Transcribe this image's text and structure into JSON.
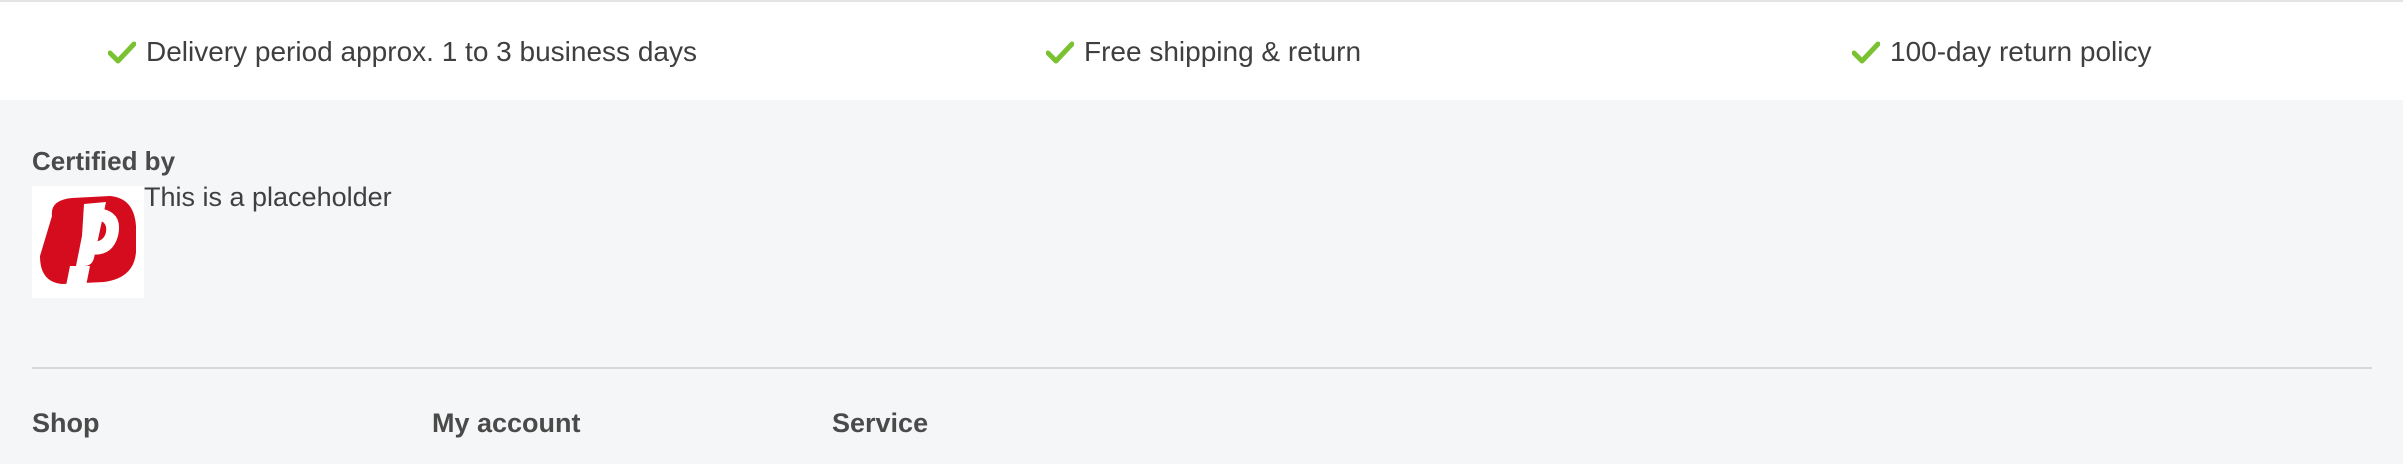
{
  "usp_bar": {
    "items": [
      {
        "icon": "check-icon",
        "label": "Delivery period approx. 1 to 3 business days"
      },
      {
        "icon": "check-icon",
        "label": "Free shipping & return"
      },
      {
        "icon": "check-icon",
        "label": "100-day return policy"
      }
    ],
    "check_color": "#7ac231"
  },
  "certified": {
    "title": "Certified by",
    "logo_icon": "trust-seal-p-logo",
    "logo_color": "#d50c1e",
    "text": "This is a placeholder"
  },
  "footer": {
    "columns": [
      {
        "title": "Shop"
      },
      {
        "title": "My account"
      },
      {
        "title": "Service"
      }
    ]
  }
}
